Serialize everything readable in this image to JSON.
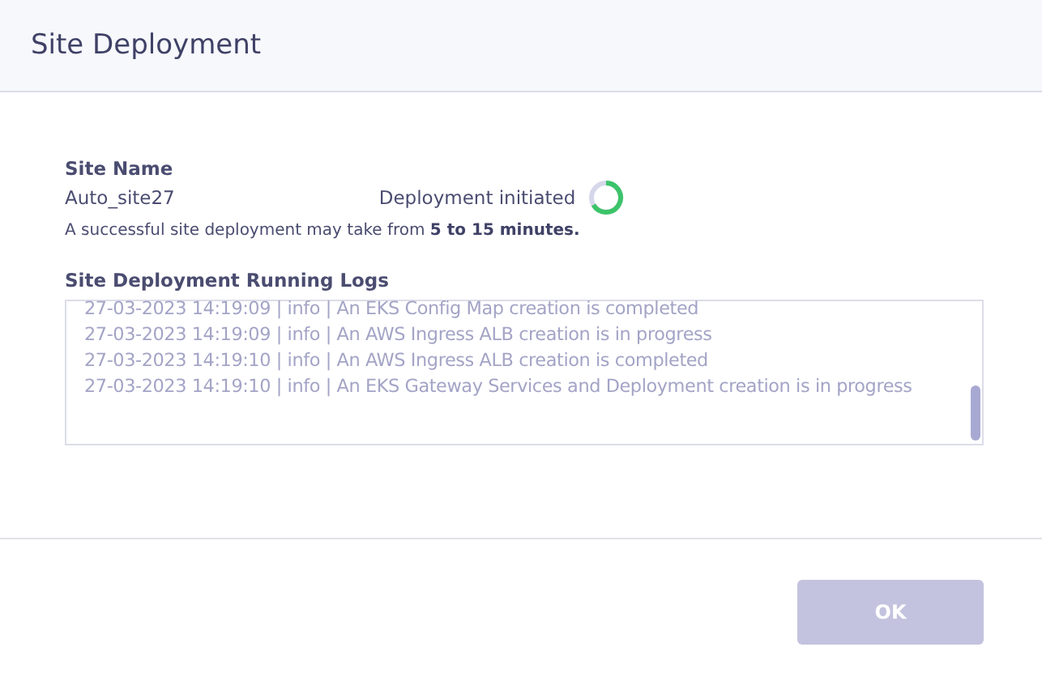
{
  "window": {
    "title": "Site Deployment"
  },
  "site_name": {
    "label": "Site Name",
    "value": "Auto_site27"
  },
  "status": {
    "text": "Deployment initiated",
    "in_progress": true
  },
  "note": "A successful site deployment may take from **5 to 15 minutes.**",
  "logs": {
    "label": "Site Deployment Running Logs",
    "lines": [
      "27-03-2023 14:19:09 | info | An EKS Config Map creation is completed",
      "27-03-2023 14:19:09 | info | An AWS Ingress ALB creation is in progress",
      "27-03-2023 14:19:10 | info | An AWS Ingress ALB creation is completed",
      "27-03-2023 14:19:10 | info | An EKS Gateway Services and Deployment creation is in progress"
    ]
  },
  "buttons": [
    {
      "label": "OK",
      "disabled": true
    }
  ]
}
